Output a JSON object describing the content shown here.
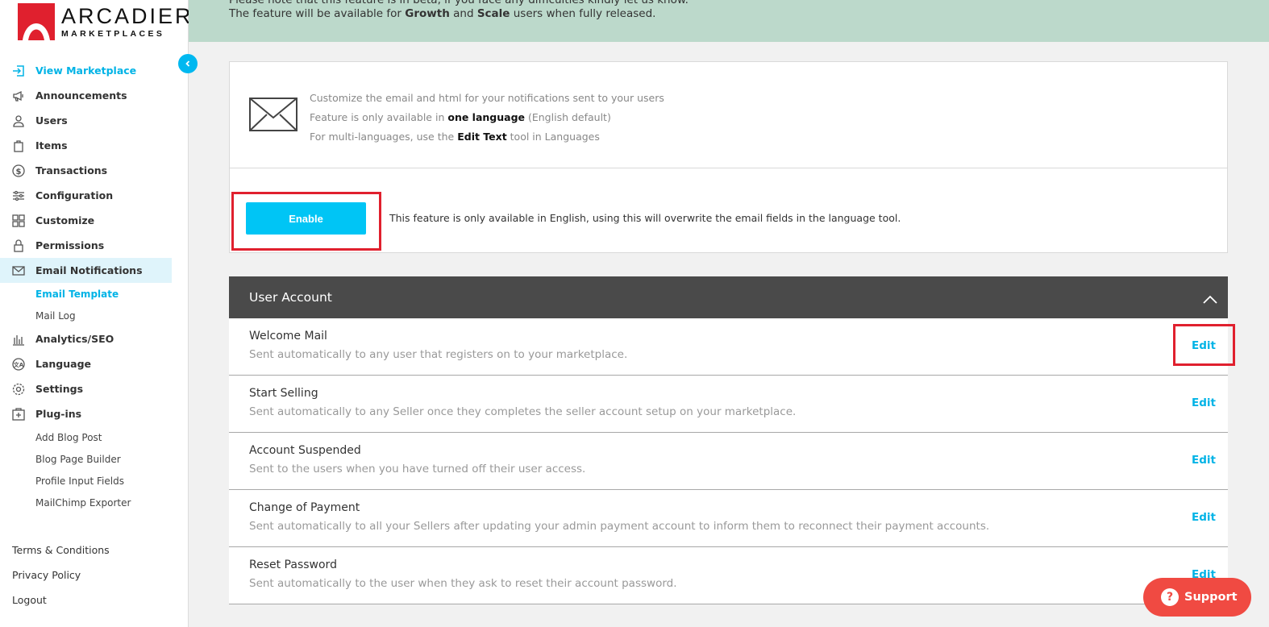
{
  "brand": {
    "name": "ARCADIER",
    "subtitle": "MARKETPLACES",
    "accent": "#00b3e6",
    "logo_red": "#e0202e"
  },
  "sidebar": {
    "items": [
      {
        "label": "View Marketplace",
        "icon": "enter-icon"
      },
      {
        "label": "Announcements",
        "icon": "megaphone-icon"
      },
      {
        "label": "Users",
        "icon": "user-icon"
      },
      {
        "label": "Items",
        "icon": "bag-icon"
      },
      {
        "label": "Transactions",
        "icon": "dollar-icon"
      },
      {
        "label": "Configuration",
        "icon": "sliders-icon"
      },
      {
        "label": "Customize",
        "icon": "grid-icon"
      },
      {
        "label": "Permissions",
        "icon": "lock-icon"
      },
      {
        "label": "Email Notifications",
        "icon": "mail-icon"
      }
    ],
    "email_sub": [
      {
        "label": "Email Template"
      },
      {
        "label": "Mail Log"
      }
    ],
    "items2": [
      {
        "label": "Analytics/SEO",
        "icon": "chart-icon"
      },
      {
        "label": "Language",
        "icon": "language-icon"
      },
      {
        "label": "Settings",
        "icon": "gear-icon"
      },
      {
        "label": "Plug-ins",
        "icon": "plugin-icon"
      }
    ],
    "plugin_sub": [
      {
        "label": "Add Blog Post"
      },
      {
        "label": "Blog Page Builder"
      },
      {
        "label": "Profile Input Fields"
      },
      {
        "label": "MailChimp Exporter"
      }
    ],
    "footer": [
      {
        "label": "Terms & Conditions"
      },
      {
        "label": "Privacy Policy"
      },
      {
        "label": "Logout"
      }
    ]
  },
  "banner": {
    "line1": "Please note that this feature is in beta, if you face any difficulties kindly let us know.",
    "line2_pre": "The feature will be available for ",
    "line2_b1": "Growth",
    "line2_mid": " and ",
    "line2_b2": "Scale",
    "line2_post": " users when fully released."
  },
  "info": {
    "line1": "Customize the email and html for your notifications sent to your users",
    "line2_pre": "Feature is only available in ",
    "line2_bold": "one language",
    "line2_post": " (English default)",
    "line3_pre": "For multi-languages, use the ",
    "line3_bold": "Edit Text",
    "line3_post": " tool in Languages",
    "enable_label": "Enable",
    "enable_note": "This feature is only available in English, using this will overwrite the email fields in the language tool."
  },
  "section": {
    "title": "User Account",
    "rows": [
      {
        "title": "Welcome Mail",
        "desc": "Sent automatically to any user that registers on to your marketplace.",
        "action": "Edit"
      },
      {
        "title": "Start Selling",
        "desc": "Sent automatically to any Seller once they completes the seller account setup on your marketplace.",
        "action": "Edit"
      },
      {
        "title": "Account Suspended",
        "desc": "Sent to the users when you have turned off their user access.",
        "action": "Edit"
      },
      {
        "title": "Change of Payment",
        "desc": "Sent automatically to all your Sellers after updating your admin payment account to inform them to reconnect their payment accounts.",
        "action": "Edit"
      },
      {
        "title": "Reset Password",
        "desc": "Sent automatically to the user when they ask to reset their account password.",
        "action": "Edit"
      }
    ]
  },
  "support": {
    "label": "Support",
    "glyph": "?"
  }
}
